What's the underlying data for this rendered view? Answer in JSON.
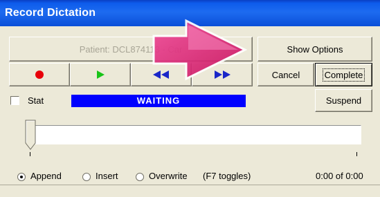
{
  "window": {
    "title": "Record Dictation"
  },
  "patient": {
    "label": "Patient: DCL874113 - Car"
  },
  "controls": {
    "record_icon": "record-icon",
    "play_icon": "play-icon",
    "rewind_icon": "rewind-icon",
    "forward_icon": "fast-forward-icon"
  },
  "buttons": {
    "show_options": "Show Options",
    "cancel": "Cancel",
    "complete": "Complete",
    "suspend": "Suspend"
  },
  "stat": {
    "label": "Stat",
    "checked": false
  },
  "status": {
    "text": "WAITING"
  },
  "mode": {
    "options": [
      "Append",
      "Insert",
      "Overwrite"
    ],
    "selected": "Append",
    "hint": "(F7 toggles)"
  },
  "timer": {
    "text": "0:00 of 0:00"
  },
  "colors": {
    "title_bar": "#0D5CEB",
    "status_bar": "#0000FF",
    "record": "#E8000A",
    "play": "#18C418",
    "transport_arrows": "#1A27C8",
    "overlay_arrow": "#E8187A"
  }
}
